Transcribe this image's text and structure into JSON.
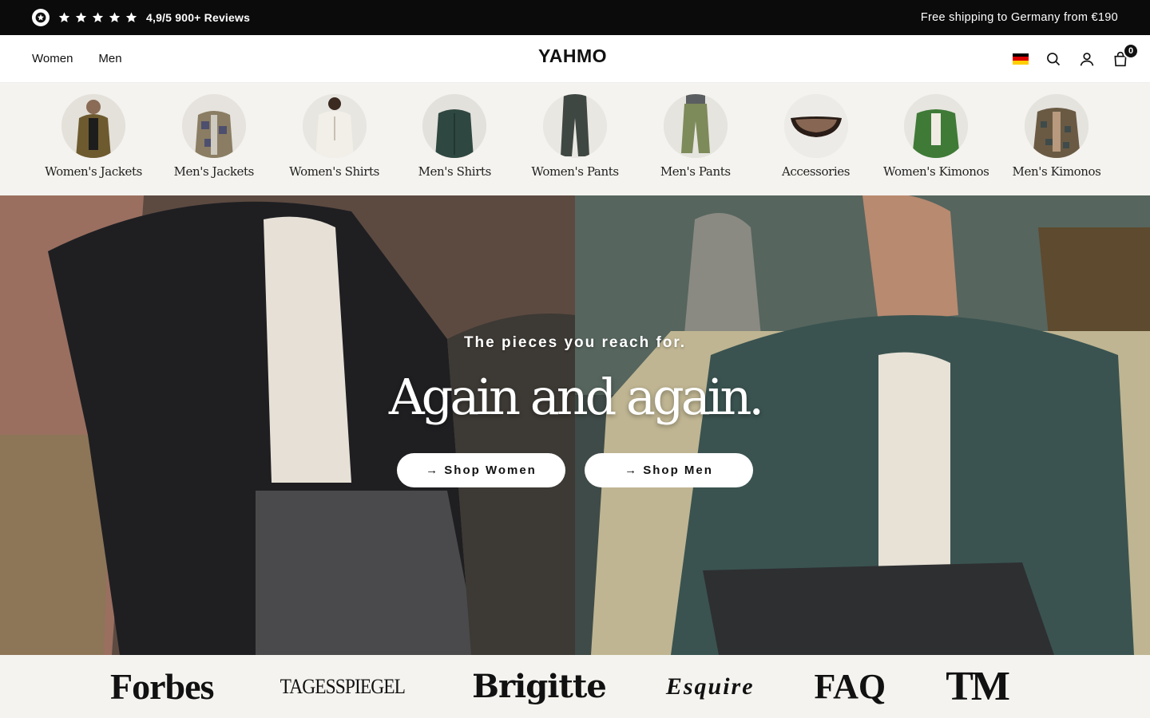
{
  "announcement": {
    "rating_text": "4,9/5 900+ Reviews",
    "shipping_text": "Free shipping to Germany from €190",
    "star_count": 5
  },
  "header": {
    "nav": [
      {
        "label": "Women"
      },
      {
        "label": "Men"
      }
    ],
    "logo": "YAHMO",
    "cart_count": "0",
    "icons": [
      "germany-flag-icon",
      "search-icon",
      "account-icon",
      "cart-icon"
    ]
  },
  "categories": [
    {
      "label": "Women's Jackets"
    },
    {
      "label": "Men's Jackets"
    },
    {
      "label": "Women's Shirts"
    },
    {
      "label": "Men's Shirts"
    },
    {
      "label": "Women's Pants"
    },
    {
      "label": "Men's Pants"
    },
    {
      "label": "Accessories"
    },
    {
      "label": "Women's Kimonos"
    },
    {
      "label": "Men's Kimonos"
    }
  ],
  "hero": {
    "subtitle": "The pieces you reach for.",
    "title": "Again and again.",
    "buttons": [
      {
        "label": "→ Shop Women"
      },
      {
        "label": "→ Shop Men"
      }
    ]
  },
  "press": {
    "logos": [
      "Forbes",
      "TAGESSPIEGEL",
      "Brigitte",
      "Esquire",
      "FAQ",
      "TM"
    ]
  },
  "colors": {
    "topbar_bg": "#0b0b0b",
    "strip_bg": "#f4f3ef",
    "button_bg": "#ffffff"
  }
}
